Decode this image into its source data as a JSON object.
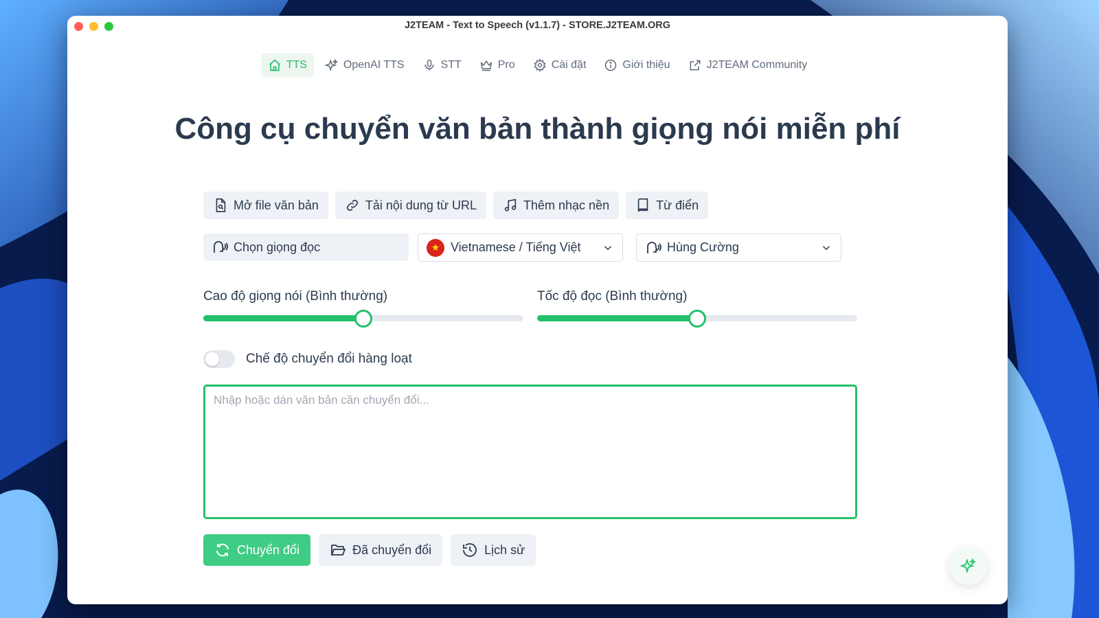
{
  "window": {
    "title": "J2TEAM - Text to Speech (v1.1.7) - STORE.J2TEAM.ORG",
    "traffic_colors": {
      "close": "#ff5f57",
      "minimize": "#febc2e",
      "maximize": "#28c840"
    }
  },
  "nav": {
    "items": [
      {
        "label": "TTS",
        "icon": "home-icon"
      },
      {
        "label": "OpenAI TTS",
        "icon": "sparkles-icon"
      },
      {
        "label": "STT",
        "icon": "microphone-icon"
      },
      {
        "label": "Pro",
        "icon": "crown-icon"
      },
      {
        "label": "Cài đặt",
        "icon": "gear-icon"
      },
      {
        "label": "Giới thiệu",
        "icon": "info-icon"
      },
      {
        "label": "J2TEAM Community",
        "icon": "external-link-icon"
      }
    ],
    "active": "TTS"
  },
  "heading": "Công cụ chuyển văn bản thành giọng nói miễn phí",
  "toolbar": {
    "open_file": "Mở file văn bản",
    "load_url": "Tải nội dung từ URL",
    "add_music": "Thêm nhạc nền",
    "dictionary": "Từ điển"
  },
  "voice": {
    "label": "Chọn giọng đọc",
    "language": "Vietnamese / Tiếng Việt",
    "speaker": "Hùng Cường"
  },
  "sliders": {
    "pitch_label": "Cao độ giọng nói (Bình thường)",
    "pitch_value": 0.5,
    "speed_label": "Tốc độ đọc (Bình thường)",
    "speed_value": 0.5
  },
  "batch": {
    "label": "Chế độ chuyển đổi hàng loạt",
    "enabled": false
  },
  "input": {
    "placeholder": "Nhập hoặc dán văn bản cần chuyển đổi...",
    "value": ""
  },
  "actions": {
    "convert": "Chuyển đổi",
    "converted": "Đã chuyển đổi",
    "history": "Lịch sử"
  },
  "colors": {
    "accent": "#22c06a",
    "accent_button": "#3fcc84",
    "text": "#2b3a4e",
    "muted_bg": "#eef1f5"
  }
}
